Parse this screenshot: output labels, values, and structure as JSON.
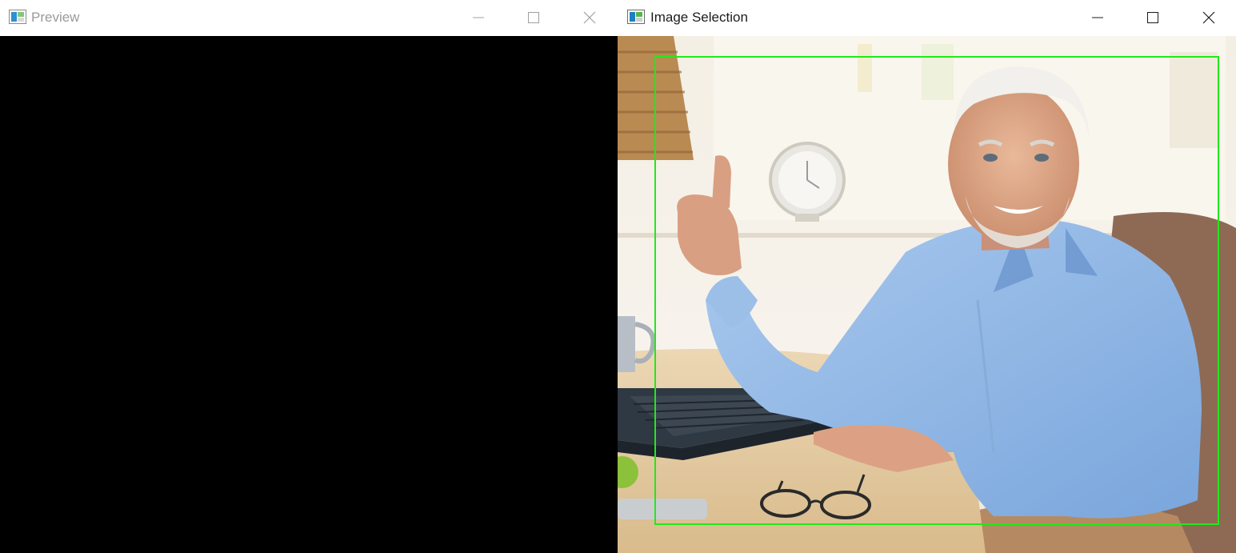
{
  "windows": {
    "preview": {
      "title": "Preview",
      "icon": "opencv-window-icon",
      "active": false,
      "canvas_color": "#000000",
      "controls": [
        "minimize-icon",
        "maximize-icon",
        "close-icon"
      ]
    },
    "selection": {
      "title": "Image Selection",
      "icon": "opencv-window-icon",
      "active": true,
      "controls": [
        "minimize-icon",
        "maximize-icon",
        "close-icon"
      ],
      "image": {
        "subject": "smiling grey-haired man in a light blue shirt giving a thumbs up at a desk with a laptop, coffee mug, clock and eyeglasses"
      },
      "selection_rectangle": {
        "color": "#22e81a"
      }
    }
  },
  "colors": {
    "inactive_title": "#9a9a9a",
    "active_title": "#1b1b1b",
    "titlebar_bg": "#ffffff"
  }
}
